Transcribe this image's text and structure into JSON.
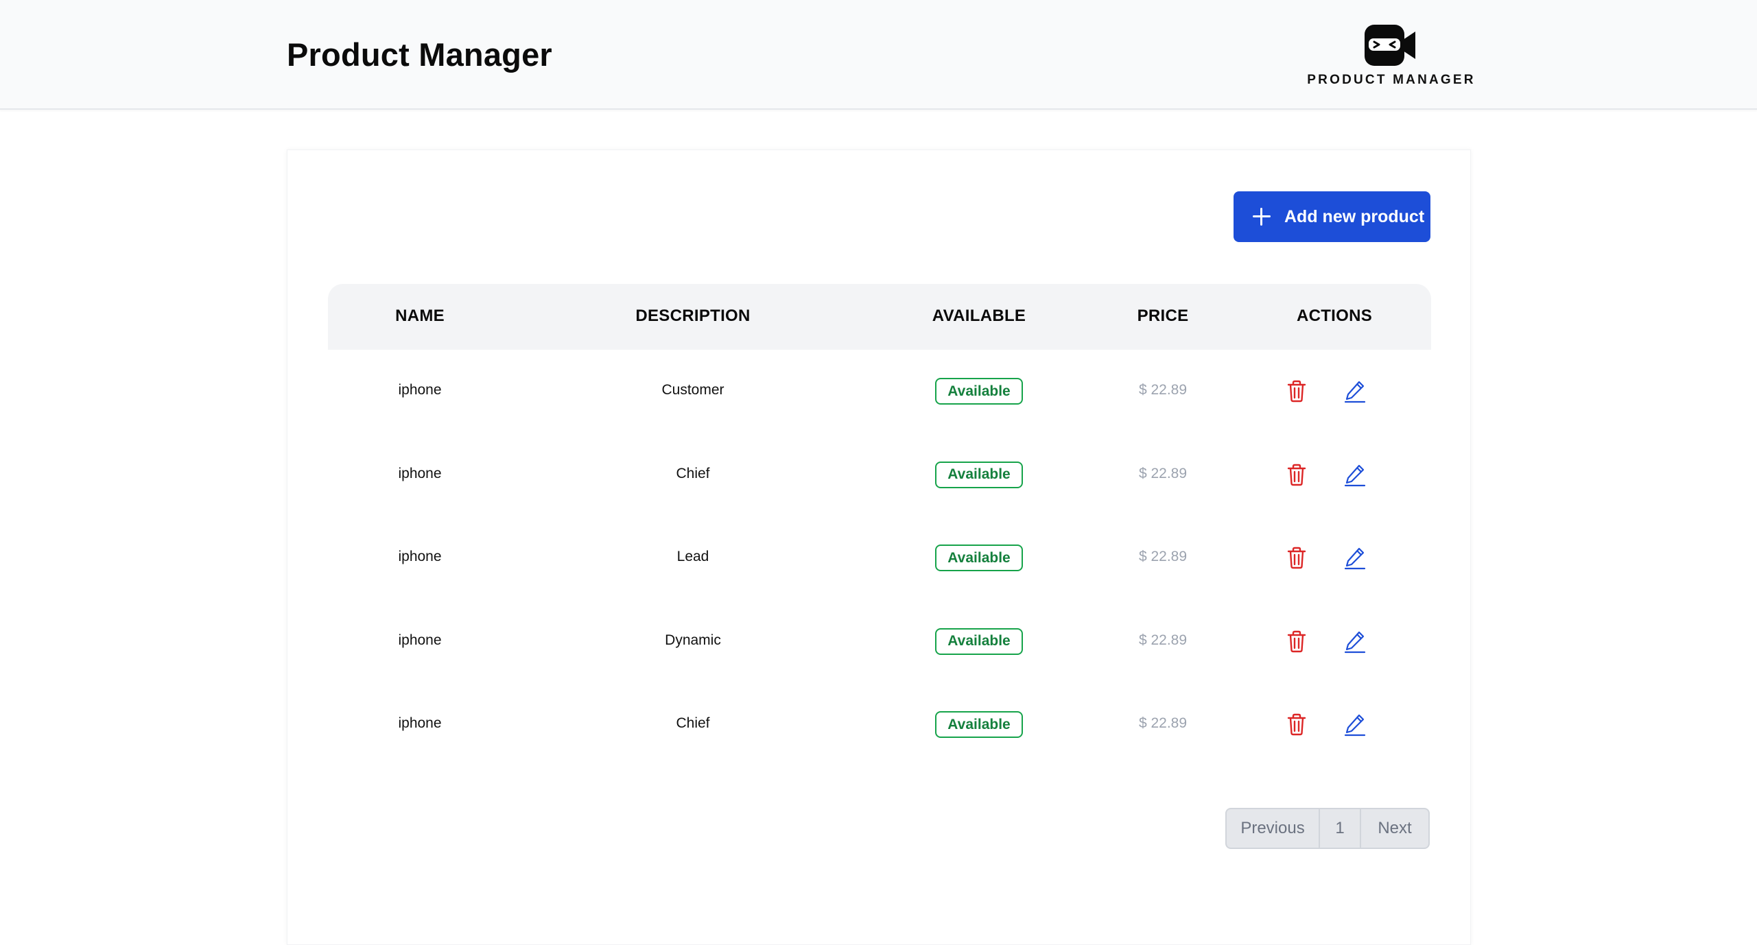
{
  "header": {
    "title": "Product Manager",
    "logo_text": "PRODUCT MANAGER"
  },
  "toolbar": {
    "add_label": "Add new product",
    "add_icon": "plus-icon"
  },
  "table": {
    "columns": [
      "NAME",
      "DESCRIPTION",
      "AVAILABLE",
      "PRICE",
      "ACTIONS"
    ],
    "rows": [
      {
        "name": "iphone",
        "description": "Customer",
        "available": "Available",
        "price": "$ 22.89"
      },
      {
        "name": "iphone",
        "description": "Chief",
        "available": "Available",
        "price": "$ 22.89"
      },
      {
        "name": "iphone",
        "description": "Lead",
        "available": "Available",
        "price": "$ 22.89"
      },
      {
        "name": "iphone",
        "description": "Dynamic",
        "available": "Available",
        "price": "$ 22.89"
      },
      {
        "name": "iphone",
        "description": "Chief",
        "available": "Available",
        "price": "$ 22.89"
      }
    ],
    "row_actions": [
      "trash-icon",
      "pencil-icon"
    ]
  },
  "pagination": {
    "previous_label": "Previous",
    "current_page": "1",
    "next_label": "Next"
  },
  "colors": {
    "accent": "#1d4ed8",
    "available": "#16a34a",
    "delete": "#dc2626",
    "edit": "#1d4ed8"
  }
}
